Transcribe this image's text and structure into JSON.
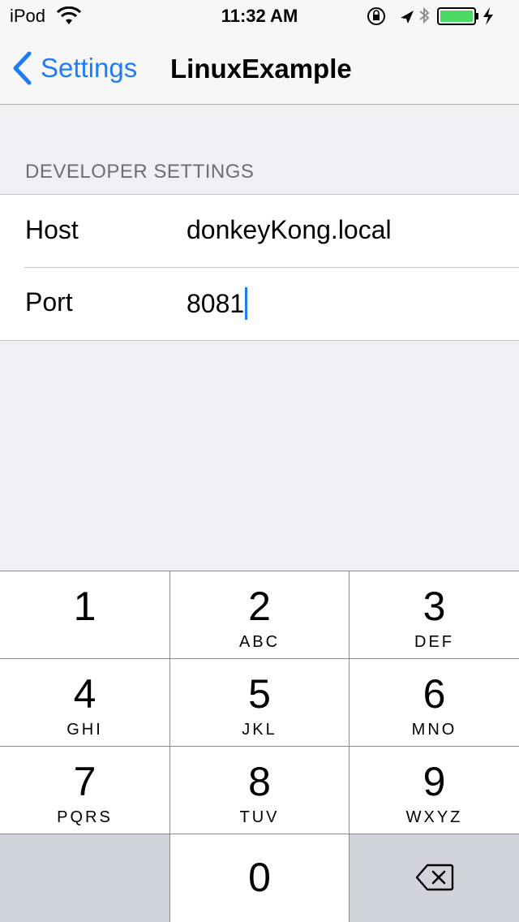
{
  "status_bar": {
    "carrier": "iPod",
    "time": "11:32 AM"
  },
  "nav": {
    "back_label": "Settings",
    "title": "LinuxExample"
  },
  "section": {
    "header": "DEVELOPER SETTINGS",
    "rows": [
      {
        "label": "Host",
        "value": "donkeyKong.local"
      },
      {
        "label": "Port",
        "value": "8081"
      }
    ]
  },
  "keypad": {
    "keys": [
      {
        "digit": "1",
        "letters": ""
      },
      {
        "digit": "2",
        "letters": "ABC"
      },
      {
        "digit": "3",
        "letters": "DEF"
      },
      {
        "digit": "4",
        "letters": "GHI"
      },
      {
        "digit": "5",
        "letters": "JKL"
      },
      {
        "digit": "6",
        "letters": "MNO"
      },
      {
        "digit": "7",
        "letters": "PQRS"
      },
      {
        "digit": "8",
        "letters": "TUV"
      },
      {
        "digit": "9",
        "letters": "WXYZ"
      },
      {
        "digit": "0",
        "letters": ""
      }
    ],
    "delete_icon": "backspace-icon"
  },
  "colors": {
    "accent": "#1f7cf6",
    "battery": "#4cd964",
    "background": "#efeff4"
  }
}
